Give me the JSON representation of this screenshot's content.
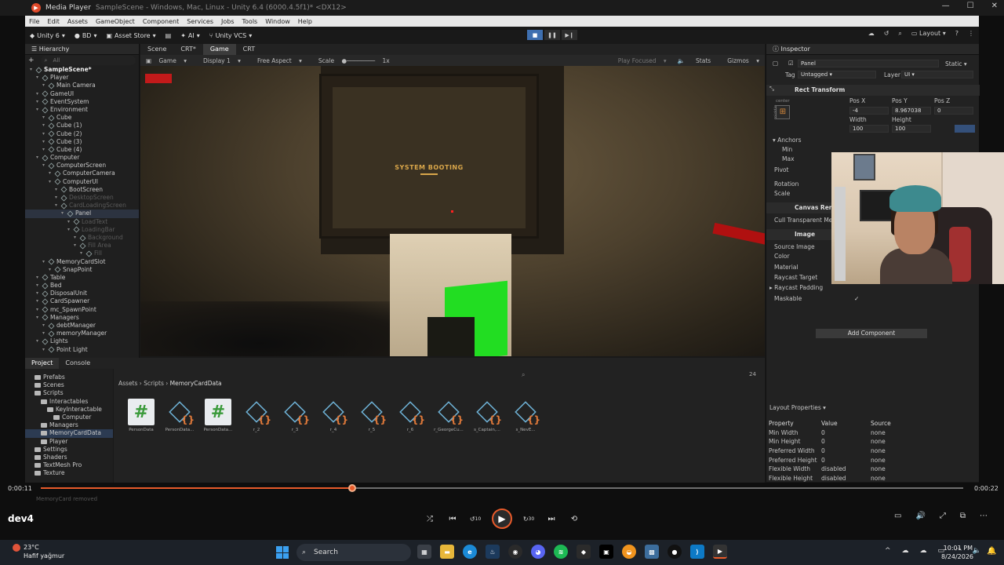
{
  "player": {
    "window_title": "Media Player",
    "behind_title": "SampleScene - Windows, Mac, Linux - Unity 6.4 (6000.4.5f1)* <DX12>",
    "current_time": "0:00:11",
    "total_time": "0:00:22",
    "progress_fraction": 0.338,
    "file_label": "dev4",
    "skip_back": "10",
    "skip_forward": "30",
    "ghost_text": "MemoryCard removed",
    "accent": "#e85a2a"
  },
  "unity": {
    "menu": [
      "File",
      "Edit",
      "Assets",
      "GameObject",
      "Component",
      "Services",
      "Jobs",
      "Tools",
      "Window",
      "Help"
    ],
    "toolbar": {
      "logo": "Unity 6",
      "account": "BD",
      "asset_store": "Asset Store",
      "ai": "AI",
      "vcs": "Unity VCS",
      "layout": "Layout"
    },
    "hierarchy": {
      "tab": "Hierarchy",
      "search_placeholder": "All",
      "items": [
        {
          "label": "SampleScene*",
          "depth": 0,
          "style": "bold"
        },
        {
          "label": "Player",
          "depth": 1
        },
        {
          "label": "Main Camera",
          "depth": 2
        },
        {
          "label": "GameUI",
          "depth": 1
        },
        {
          "label": "EventSystem",
          "depth": 1
        },
        {
          "label": "Environment",
          "depth": 1
        },
        {
          "label": "Cube",
          "depth": 2
        },
        {
          "label": "Cube (1)",
          "depth": 2
        },
        {
          "label": "Cube (2)",
          "depth": 2
        },
        {
          "label": "Cube (3)",
          "depth": 2
        },
        {
          "label": "Cube (4)",
          "depth": 2
        },
        {
          "label": "Computer",
          "depth": 1
        },
        {
          "label": "ComputerScreen",
          "depth": 2
        },
        {
          "label": "ComputerCamera",
          "depth": 3
        },
        {
          "label": "ComputerUI",
          "depth": 3
        },
        {
          "label": "BootScreen",
          "depth": 4
        },
        {
          "label": "DesktopScreen",
          "depth": 4,
          "style": "dim"
        },
        {
          "label": "CardLoadingScreen",
          "depth": 4,
          "style": "dim"
        },
        {
          "label": "Panel",
          "depth": 5,
          "style": "sel"
        },
        {
          "label": "LoadText",
          "depth": 6,
          "style": "dim"
        },
        {
          "label": "LoadingBar",
          "depth": 6,
          "style": "dim"
        },
        {
          "label": "Background",
          "depth": 7,
          "style": "dim"
        },
        {
          "label": "Fill Area",
          "depth": 7,
          "style": "dim"
        },
        {
          "label": "Fill",
          "depth": 8,
          "style": "dim"
        },
        {
          "label": "MemoryCardSlot",
          "depth": 2
        },
        {
          "label": "SnapPoint",
          "depth": 3
        },
        {
          "label": "Table",
          "depth": 1
        },
        {
          "label": "Bed",
          "depth": 1
        },
        {
          "label": "DisposalUnit",
          "depth": 1
        },
        {
          "label": "CardSpawner",
          "depth": 1
        },
        {
          "label": "mc_SpawnPoint",
          "depth": 1
        },
        {
          "label": "Managers",
          "depth": 1
        },
        {
          "label": "debtManager",
          "depth": 2
        },
        {
          "label": "memoryManager",
          "depth": 2
        },
        {
          "label": "Lights",
          "depth": 1
        },
        {
          "label": "Point Light",
          "depth": 2
        }
      ]
    },
    "view_tabs": [
      "Scene",
      "CRT*",
      "Game",
      "CRT"
    ],
    "game_toolbar": {
      "mode": "Game",
      "display": "Display 1",
      "aspect": "Free Aspect",
      "scale_label": "Scale",
      "scale_value": "1x",
      "play_focused": "Play Focused",
      "stats": "Stats",
      "gizmos": "Gizmos"
    },
    "game_view": {
      "boot_text": "SYSTEM BOOTING"
    },
    "inspector": {
      "tab": "Inspector",
      "object_name": "Panel",
      "static_label": "Static",
      "tag_label": "Tag",
      "tag_value": "Untagged",
      "layer_label": "Layer",
      "layer_value": "UI",
      "rect_transform": "Rect Transform",
      "anchor_preset_top": "center",
      "anchor_preset_side": "middle",
      "pos_x_label": "Pos X",
      "pos_y_label": "Pos Y",
      "pos_z_label": "Pos Z",
      "pos_x": "-4",
      "pos_y": "8.967038",
      "pos_z": "0",
      "width_label": "Width",
      "height_label": "Height",
      "width": "100",
      "height": "100",
      "anchors": "Anchors",
      "min": "Min",
      "max": "Max",
      "pivot": "Pivot",
      "rotation": "Rotation",
      "scale": "Scale",
      "canvas_renderer": "Canvas Renderer",
      "cull_transparent": "Cull Transparent Mesh",
      "image": "Image",
      "source_image": "Source Image",
      "color": "Color",
      "material": "Material",
      "raycast_target": "Raycast Target",
      "raycast_padding": "Raycast Padding",
      "maskable": "Maskable",
      "add_component": "Add Component",
      "layout_properties": "Layout Properties",
      "layout_headers": [
        "Property",
        "Value",
        "Source"
      ],
      "layout_rows": [
        [
          "Min Width",
          "0",
          "none"
        ],
        [
          "Min Height",
          "0",
          "none"
        ],
        [
          "Preferred Width",
          "0",
          "none"
        ],
        [
          "Preferred Height",
          "0",
          "none"
        ],
        [
          "Flexible Width",
          "disabled",
          "none"
        ],
        [
          "Flexible Height",
          "disabled",
          "none"
        ]
      ]
    },
    "bottom_tabs": [
      "Project",
      "Console"
    ],
    "project": {
      "folders": [
        {
          "label": "Prefabs",
          "depth": 1
        },
        {
          "label": "Scenes",
          "depth": 1
        },
        {
          "label": "Scripts",
          "depth": 1
        },
        {
          "label": "Interactables",
          "depth": 2
        },
        {
          "label": "KeyInteractable",
          "depth": 3
        },
        {
          "label": "Computer",
          "depth": 4
        },
        {
          "label": "Managers",
          "depth": 2
        },
        {
          "label": "MemoryCardData",
          "depth": 2,
          "style": "sel"
        },
        {
          "label": "Player",
          "depth": 2
        },
        {
          "label": "Settings",
          "depth": 1
        },
        {
          "label": "Shaders",
          "depth": 1
        },
        {
          "label": "TextMesh Pro",
          "depth": 1
        },
        {
          "label": "Texture",
          "depth": 1
        }
      ],
      "breadcrumb": [
        "Assets",
        "Scripts",
        "MemoryCardData"
      ],
      "item_count": "24",
      "assets": [
        {
          "label": "PersonData",
          "kind": "cs"
        },
        {
          "label": "PersonData...",
          "kind": "so"
        },
        {
          "label": "PersonData...",
          "kind": "cs"
        },
        {
          "label": "r_2",
          "kind": "so"
        },
        {
          "label": "r_3",
          "kind": "so"
        },
        {
          "label": "r_4",
          "kind": "so"
        },
        {
          "label": "r_5",
          "kind": "so"
        },
        {
          "label": "r_6",
          "kind": "so"
        },
        {
          "label": "r_GeorgeCu...",
          "kind": "so"
        },
        {
          "label": "s_Captain,...",
          "kind": "so"
        },
        {
          "label": "s_NevE...",
          "kind": "so"
        }
      ]
    }
  },
  "taskbar": {
    "temperature": "23°C",
    "weather": "Hafif yağmur",
    "search": "Search",
    "time": "10:01 PM",
    "date": "8/24/2026"
  }
}
